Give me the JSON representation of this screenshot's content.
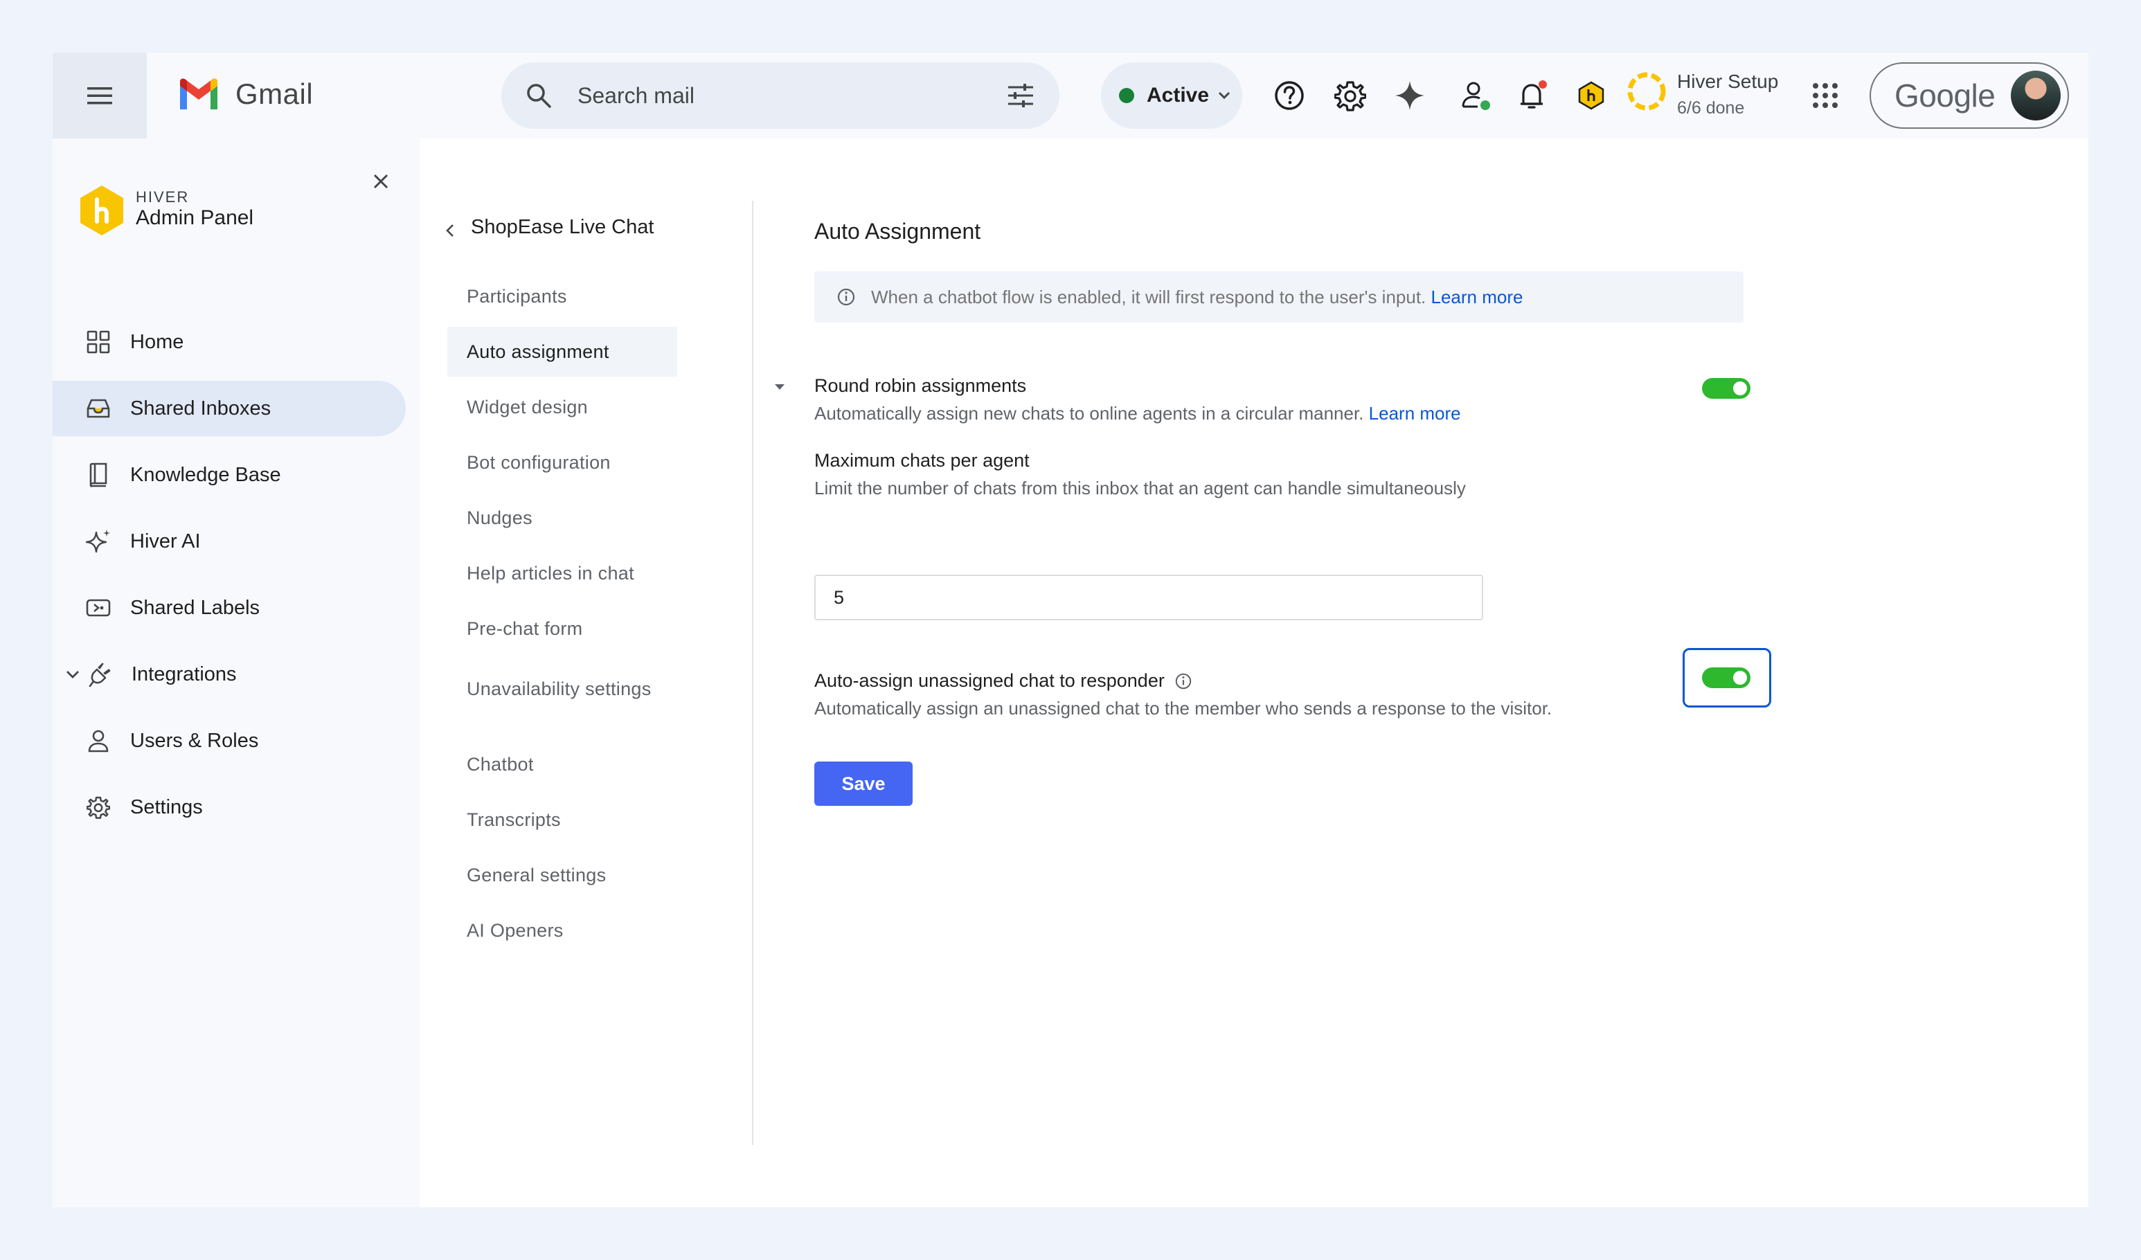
{
  "topbar": {
    "app_name": "Gmail",
    "search_placeholder": "Search mail",
    "status_label": "Active",
    "setup_title": "Hiver Setup",
    "setup_progress": "6/6 done",
    "account_brand": "Google"
  },
  "admin": {
    "brand": "HIVER",
    "title": "Admin Panel",
    "nav": [
      {
        "label": "Home",
        "icon": "grid-icon"
      },
      {
        "label": "Shared Inboxes",
        "icon": "inbox-icon",
        "active": true
      },
      {
        "label": "Knowledge Base",
        "icon": "book-icon"
      },
      {
        "label": "Hiver AI",
        "icon": "sparkle-icon"
      },
      {
        "label": "Shared Labels",
        "icon": "label-icon"
      },
      {
        "label": "Integrations",
        "icon": "plug-icon",
        "expandable": true
      },
      {
        "label": "Users & Roles",
        "icon": "user-icon"
      },
      {
        "label": "Settings",
        "icon": "gear-icon"
      }
    ]
  },
  "inbox": {
    "name": "ShopEase Live Chat",
    "menu": [
      "Participants",
      "Auto assignment",
      "Widget design",
      "Bot configuration",
      "Nudges",
      "Help articles in chat",
      "Pre-chat form",
      "Unavailability settings",
      "Chatbot",
      "Transcripts",
      "General settings",
      "AI Openers"
    ],
    "active_menu": "Auto assignment"
  },
  "content": {
    "title": "Auto Assignment",
    "info_text": "When a chatbot flow is enabled, it will first respond to the user's input.",
    "info_link": "Learn more",
    "round_robin": {
      "title": "Round robin assignments",
      "desc": "Automatically assign new chats to online agents in a circular manner.",
      "link": "Learn more",
      "enabled": true
    },
    "max_chats": {
      "title": "Maximum chats per agent",
      "desc": "Limit the number of chats from this inbox that an agent can handle simultaneously",
      "value": "5"
    },
    "auto_assign": {
      "title": "Auto-assign unassigned chat to responder",
      "desc": "Automatically assign an unassigned chat to the member who sends a response to the visitor.",
      "enabled": true
    },
    "save_label": "Save"
  },
  "colors": {
    "accent": "#4466f2",
    "toggle_on": "#2eb82e",
    "link": "#0b57d0",
    "active_nav": "#e1e8f6"
  }
}
